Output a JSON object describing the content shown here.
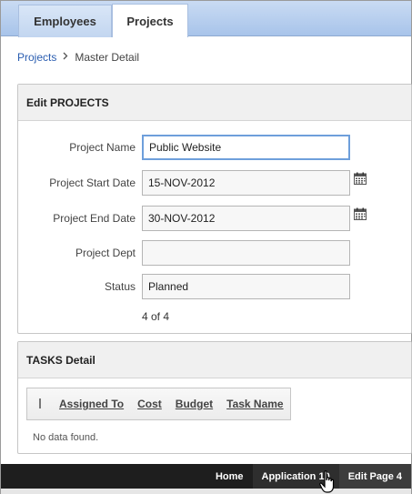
{
  "tabs": [
    {
      "label": "Employees",
      "active": false
    },
    {
      "label": "Projects",
      "active": true
    }
  ],
  "breadcrumb": {
    "link": "Projects",
    "current": "Master Detail"
  },
  "edit_region": {
    "title": "Edit PROJECTS",
    "fields": {
      "project_name": {
        "label": "Project Name",
        "value": "Public Website"
      },
      "start_date": {
        "label": "Project Start Date",
        "value": "15-NOV-2012"
      },
      "end_date": {
        "label": "Project End Date",
        "value": "30-NOV-2012"
      },
      "project_dept": {
        "label": "Project Dept",
        "value": ""
      },
      "status": {
        "label": "Status",
        "value": "Planned"
      }
    },
    "record_counter": "4 of 4"
  },
  "tasks_region": {
    "title": "TASKS Detail",
    "columns": [
      "Assigned To",
      "Cost",
      "Budget",
      "Task Name"
    ],
    "no_data": "No data found."
  },
  "devbar": {
    "home": "Home",
    "application": "Application 10",
    "edit_page": "Edit Page 4"
  },
  "icons": {
    "calendar": "calendar-icon",
    "breadcrumb_separator": "chevron-right-icon",
    "cursor": "hand-pointer-icon"
  },
  "colors": {
    "tab_bar": "#a8c4ea",
    "link": "#2a5db0",
    "focus_border": "#6e9fdb",
    "devbar": "#1e1e1e"
  }
}
